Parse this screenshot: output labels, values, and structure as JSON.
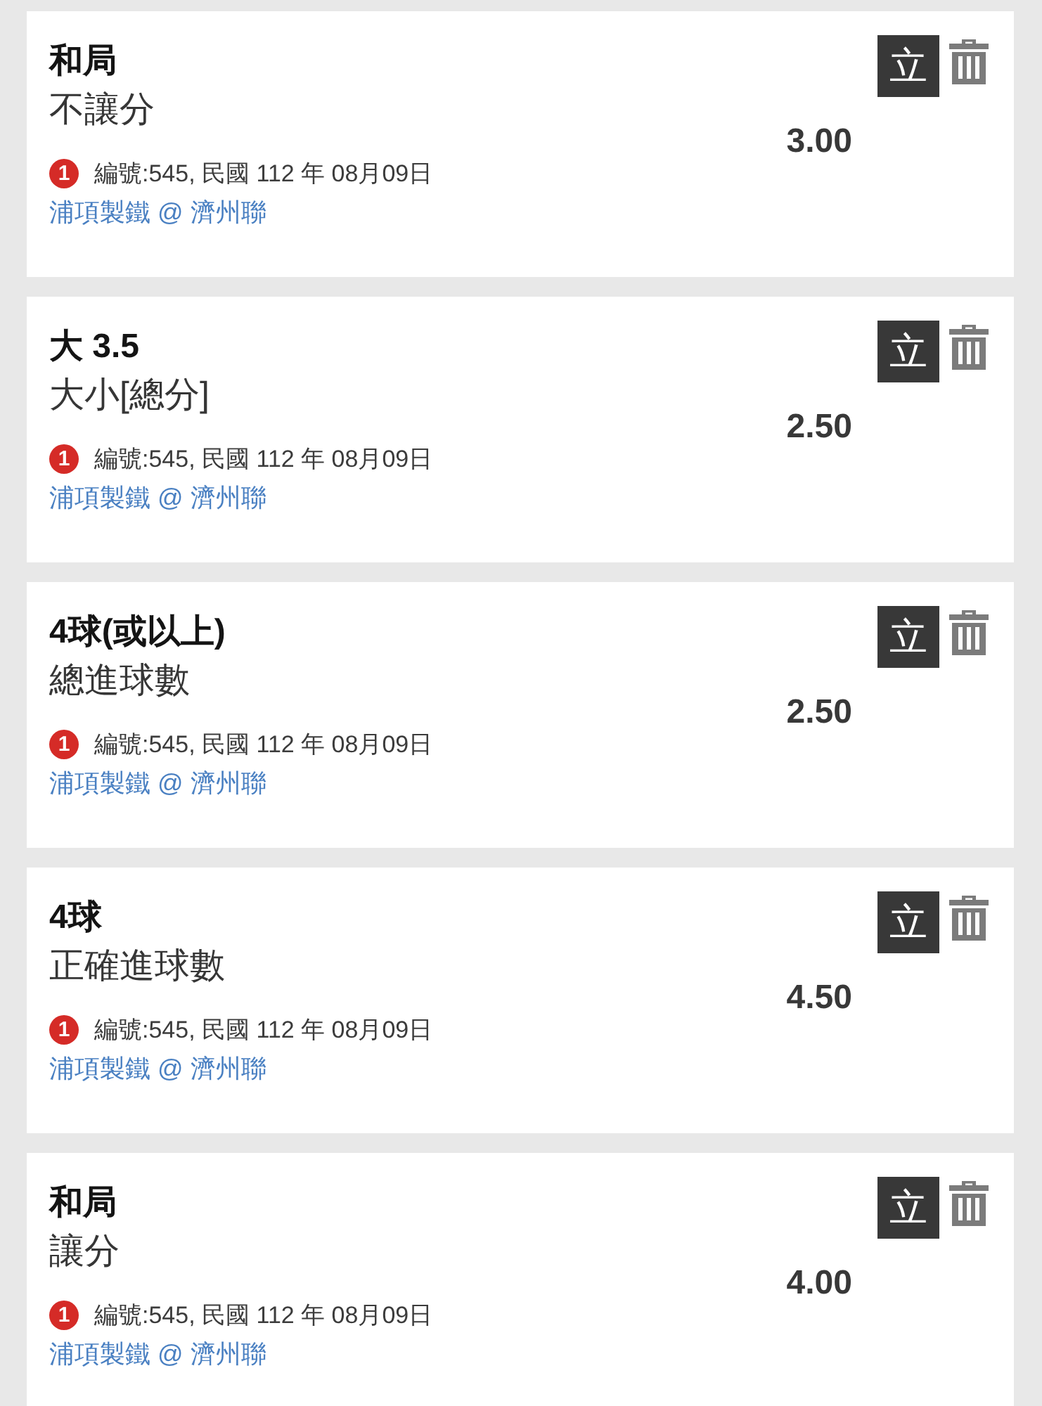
{
  "bets": [
    {
      "selection": "和局",
      "market": "不讓分",
      "odds": "3.00",
      "badge": "1",
      "info": "編號:545, 民國 112 年 08月09日",
      "match": "浦項製鐵 @ 濟州聯",
      "action": "立"
    },
    {
      "selection": "大 3.5",
      "market": "大小[總分]",
      "odds": "2.50",
      "badge": "1",
      "info": "編號:545, 民國 112 年 08月09日",
      "match": "浦項製鐵 @ 濟州聯",
      "action": "立"
    },
    {
      "selection": "4球(或以上)",
      "market": "總進球數",
      "odds": "2.50",
      "badge": "1",
      "info": "編號:545, 民國 112 年 08月09日",
      "match": "浦項製鐵 @ 濟州聯",
      "action": "立"
    },
    {
      "selection": "4球",
      "market": "正確進球數",
      "odds": "4.50",
      "badge": "1",
      "info": "編號:545, 民國 112 年 08月09日",
      "match": "浦項製鐵 @ 濟州聯",
      "action": "立"
    },
    {
      "selection": "和局",
      "market": "讓分",
      "odds": "4.00",
      "badge": "1",
      "info": "編號:545, 民國 112 年 08月09日",
      "match": "浦項製鐵 @ 濟州聯",
      "action": "立"
    }
  ]
}
